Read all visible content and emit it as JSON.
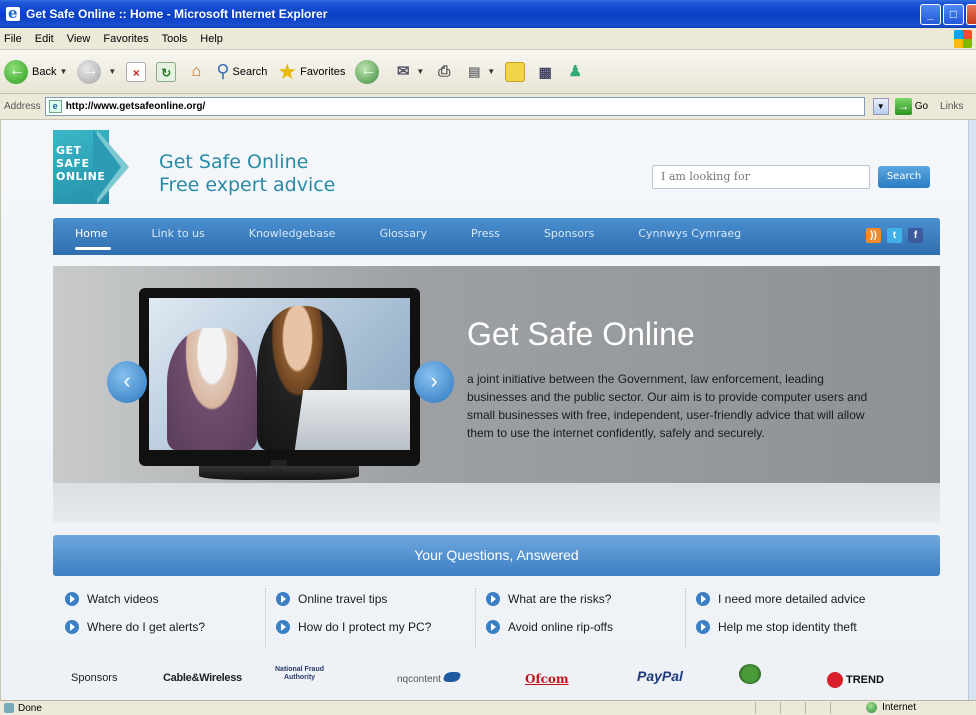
{
  "window": {
    "title": "Get Safe Online :: Home - Microsoft Internet Explorer",
    "min_label": "_",
    "max_label": "□",
    "close_label": "x"
  },
  "menu": [
    "File",
    "Edit",
    "View",
    "Favorites",
    "Tools",
    "Help"
  ],
  "toolbar": {
    "back_label": "Back",
    "search_label": "Search",
    "favorites_label": "Favorites"
  },
  "address": {
    "label": "Address",
    "url": "http://www.getsafeonline.org/",
    "go_label": "Go",
    "links_label": "Links"
  },
  "site": {
    "logo_lines": [
      "GET",
      "SAFE",
      "ONLINE"
    ],
    "brand_line1": "Get Safe Online",
    "brand_line2": "Free expert advice",
    "search_placeholder": "I am looking for",
    "search_button": "Search",
    "nav": [
      "Home",
      "Link to us",
      "Knowledgebase",
      "Glossary",
      "Press",
      "Sponsors",
      "Cynnwys Cymraeg"
    ],
    "social": [
      {
        "name": "rss",
        "glyph": "))",
        "color": "#f08a2a"
      },
      {
        "name": "twitter",
        "glyph": "t",
        "color": "#3fb0e8"
      },
      {
        "name": "facebook",
        "glyph": "f",
        "color": "#3b5b9d"
      }
    ],
    "hero": {
      "title": "Get Safe Online",
      "text": "a joint initiative between the Government, law enforcement, leading businesses and the public sector. Our aim is to provide computer users and small businesses with free, independent, user-friendly advice that will allow them to use the internet confidently, safely and securely."
    },
    "questions_title": "Your Questions, Answered",
    "questions": [
      [
        "Watch videos",
        "Where do I get alerts?"
      ],
      [
        "Online travel tips",
        "How do I protect my PC?"
      ],
      [
        "What are the risks?",
        "Avoid online rip-offs"
      ],
      [
        "I need more detailed advice",
        "Help me stop identity theft"
      ]
    ],
    "sponsors": {
      "label": "Sponsors",
      "cable": "Cable&Wireless",
      "nfa_line1": "National Fraud",
      "nfa_line2": "Authority",
      "nq": "nqcontent",
      "ofcom": "Ofcom",
      "paypal": "PayPal",
      "trend": "TREND"
    }
  },
  "status": {
    "text": "Done",
    "zone": "Internet"
  }
}
